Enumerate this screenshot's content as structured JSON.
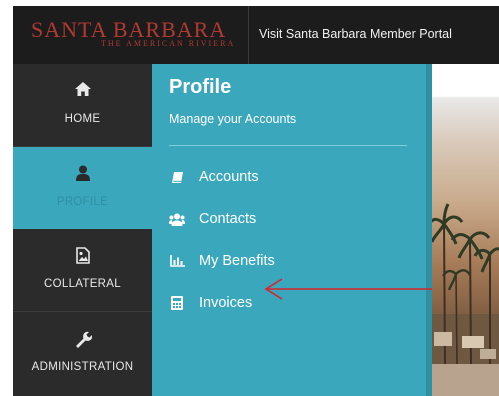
{
  "header": {
    "brand_name": "SANTA BARBARA",
    "brand_tagline": "THE AMERICAN RIVIERA",
    "portal_link": "Visit Santa Barbara Member Portal"
  },
  "rail": {
    "items": [
      {
        "label": "HOME",
        "icon": "home-icon"
      },
      {
        "label": "PROFILE",
        "icon": "user-icon",
        "active": true
      },
      {
        "label": "COLLATERAL",
        "icon": "image-file-icon"
      },
      {
        "label": "ADMINISTRATION",
        "icon": "wrench-icon"
      }
    ]
  },
  "flyout": {
    "title": "Profile",
    "subtitle": "Manage your Accounts",
    "items": [
      {
        "label": "Accounts",
        "icon": "book-icon"
      },
      {
        "label": "Contacts",
        "icon": "users-icon"
      },
      {
        "label": "My Benefits",
        "icon": "chart-icon"
      },
      {
        "label": "Invoices",
        "icon": "calculator-icon"
      }
    ]
  },
  "colors": {
    "accent": "#3aa7bd",
    "brand_red": "#b03a32",
    "arrow_red": "#d9232a",
    "rail_bg": "#2b2b2b"
  }
}
